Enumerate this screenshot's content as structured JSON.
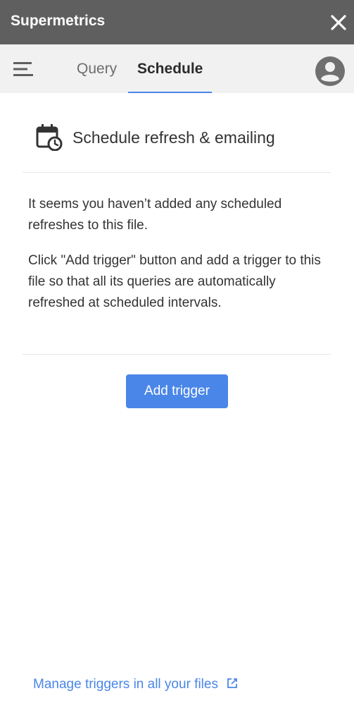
{
  "app": {
    "title": "Supermetrics"
  },
  "window_controls": {
    "close_icon": "close-icon"
  },
  "nav": {
    "menu_icon": "menu-icon",
    "tabs": [
      {
        "label": "Query",
        "active": false
      },
      {
        "label": "Schedule",
        "active": true
      }
    ],
    "avatar_icon": "account-circle-icon"
  },
  "schedule": {
    "icon": "calendar-clock-icon",
    "title": "Schedule refresh & emailing",
    "empty_message": "It seems you haven’t added any scheduled refreshes to this file.",
    "instruction": "Click \"Add trigger\" button and add a trigger to this file so that all its queries are automatically refreshed at scheduled intervals.",
    "add_trigger_label": "Add trigger"
  },
  "footer": {
    "manage_link": "Manage triggers in all your files",
    "manage_link_icon": "external-link-icon"
  },
  "colors": {
    "titlebar": "#5f5f5f",
    "navbar": "#f1f1f1",
    "accent": "#4a86e8"
  }
}
